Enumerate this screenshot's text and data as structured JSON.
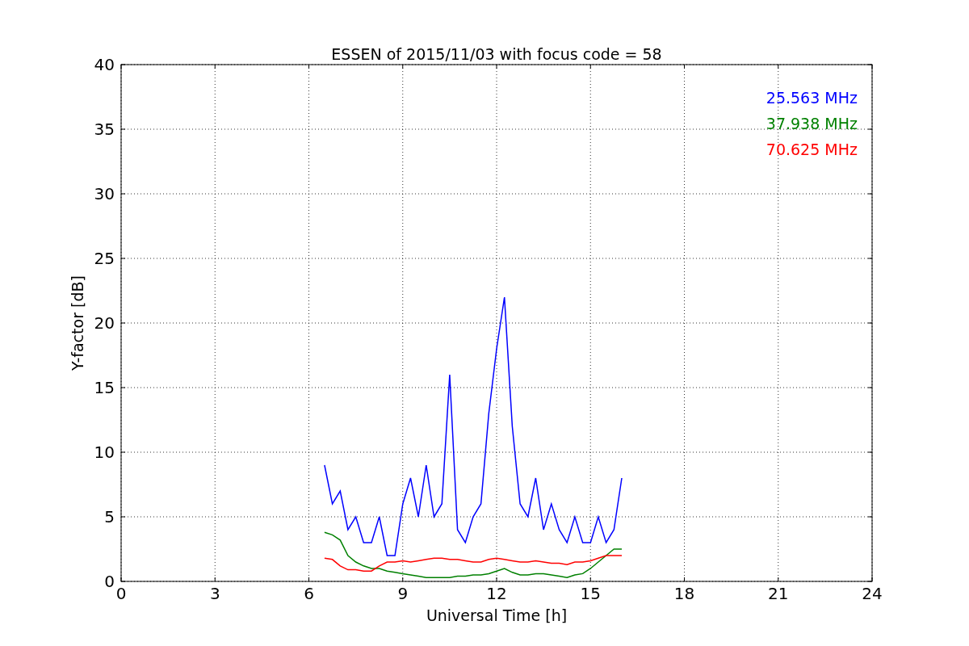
{
  "chart_data": {
    "type": "line",
    "title": "ESSEN of 2015/11/03 with focus code = 58",
    "xlabel": "Universal Time [h]",
    "ylabel": "Y-factor [dB]",
    "x": [
      6.5,
      6.75,
      7,
      7.25,
      7.5,
      7.75,
      8,
      8.25,
      8.5,
      8.75,
      9,
      9.25,
      9.5,
      9.75,
      10,
      10.25,
      10.5,
      10.75,
      11,
      11.25,
      11.5,
      11.75,
      12,
      12.25,
      12.5,
      12.75,
      13,
      13.25,
      13.5,
      13.75,
      14,
      14.25,
      14.5,
      14.75,
      15,
      15.25,
      15.5,
      15.75,
      16
    ],
    "series": [
      {
        "name": "25.563 MHz",
        "color": "#0000ff",
        "values": [
          9,
          6,
          7,
          4,
          5,
          3,
          3,
          5,
          2,
          2,
          6,
          8,
          5,
          9,
          5,
          6,
          16,
          4,
          3,
          5,
          6,
          13,
          18,
          22,
          12,
          6,
          5,
          8,
          4,
          6,
          4,
          3,
          5,
          3,
          3,
          5,
          3,
          4,
          8
        ]
      },
      {
        "name": "37.938 MHz",
        "color": "#008000",
        "values": [
          3.8,
          3.6,
          3.2,
          2,
          1.5,
          1.2,
          1,
          1,
          0.8,
          0.7,
          0.6,
          0.5,
          0.4,
          0.3,
          0.3,
          0.3,
          0.3,
          0.4,
          0.4,
          0.5,
          0.5,
          0.6,
          0.8,
          1,
          0.7,
          0.5,
          0.5,
          0.6,
          0.6,
          0.5,
          0.4,
          0.3,
          0.5,
          0.6,
          1,
          1.5,
          2,
          2.5,
          2.5
        ]
      },
      {
        "name": "70.625 MHz",
        "color": "#ff0000",
        "values": [
          1.8,
          1.7,
          1.2,
          0.9,
          0.9,
          0.8,
          0.8,
          1.2,
          1.5,
          1.5,
          1.6,
          1.5,
          1.6,
          1.7,
          1.8,
          1.8,
          1.7,
          1.7,
          1.6,
          1.5,
          1.5,
          1.7,
          1.8,
          1.7,
          1.6,
          1.5,
          1.5,
          1.6,
          1.5,
          1.4,
          1.4,
          1.3,
          1.5,
          1.5,
          1.6,
          1.8,
          2,
          2,
          2
        ]
      }
    ],
    "grid": true,
    "xlim": [
      0,
      24
    ],
    "ylim": [
      0,
      40
    ],
    "xticks": [
      0,
      3,
      6,
      9,
      12,
      15,
      18,
      21,
      24
    ],
    "yticks": [
      0,
      5,
      10,
      15,
      20,
      25,
      30,
      35,
      40
    ]
  }
}
